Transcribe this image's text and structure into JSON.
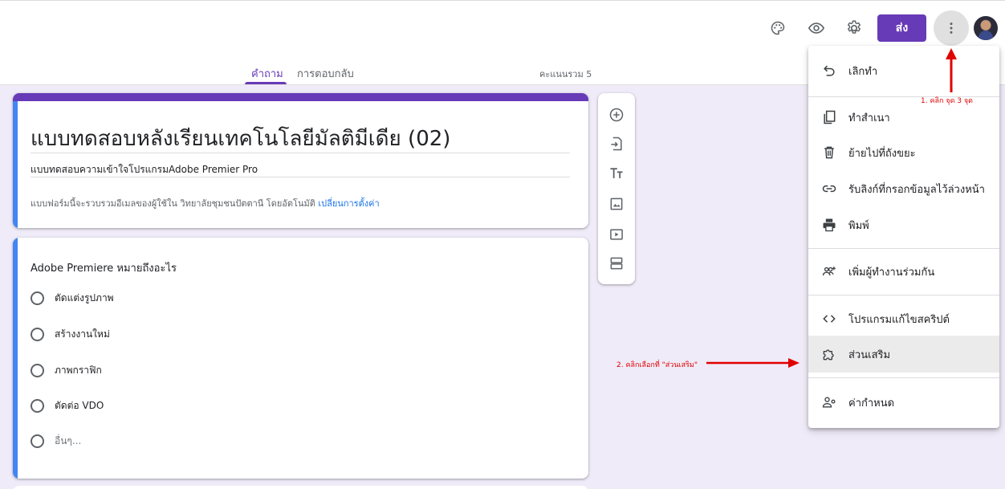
{
  "header": {
    "palette_icon": "palette-icon",
    "preview_icon": "eye-icon",
    "settings_icon": "gear-icon",
    "send_label": "ส่ง",
    "more_icon": "more-vert-icon",
    "avatar": "avatar"
  },
  "tabs": {
    "questions": "คำถาม",
    "responses": "การตอบกลับ",
    "total_score": "คะแนนรวม 5"
  },
  "form": {
    "title": "แบบทดสอบหลังเรียนเทคโนโลยีมัลติมีเดีย (02)",
    "description": "แบบทดสอบความเข้าใจโปรแกรมAdobe Premier Pro",
    "email_note": "แบบฟอร์มนี้จะรวบรวมอีเมลของผู้ใช้ใน วิทยาลัยชุมชนปัตตานี โดยอัตโนมัติ",
    "change_settings": "เปลี่ยนการตั้งค่า"
  },
  "question": {
    "title": "Adobe Premiere หมายถึงอะไร",
    "options": [
      "ตัดแต่งรูปภาพ",
      "สร้างงานใหม่",
      "ภาพกราฟิก",
      "ตัดต่อ VDO"
    ],
    "other": "อื่นๆ..."
  },
  "menu": {
    "items": [
      {
        "label": "เลิกทำ",
        "icon": "undo-icon"
      },
      {
        "label": "ทำสำเนา",
        "icon": "copy-icon"
      },
      {
        "label": "ย้ายไปที่ถังขยะ",
        "icon": "trash-icon"
      },
      {
        "label": "รับลิงก์ที่กรอกข้อมูลไว้ล่วงหน้า",
        "icon": "link-icon"
      },
      {
        "label": "พิมพ์",
        "icon": "print-icon"
      },
      {
        "label": "เพิ่มผู้ทำงานร่วมกัน",
        "icon": "add-people-icon"
      },
      {
        "label": "โปรแกรมแก้ไขสคริปต์",
        "icon": "code-icon"
      },
      {
        "label": "ส่วนเสริม",
        "icon": "puzzle-icon"
      },
      {
        "label": "ค่ากำหนด",
        "icon": "preferences-icon"
      }
    ]
  },
  "annotations": {
    "step1": "1. คลิก จุด 3 จุด",
    "step2": "2. คลิกเลือกที่ \"ส่วนเสริม\""
  },
  "colors": {
    "accent": "#673ab7",
    "link": "#1a73e8",
    "annotation": "#e00000",
    "background": "#f0ebf8"
  }
}
